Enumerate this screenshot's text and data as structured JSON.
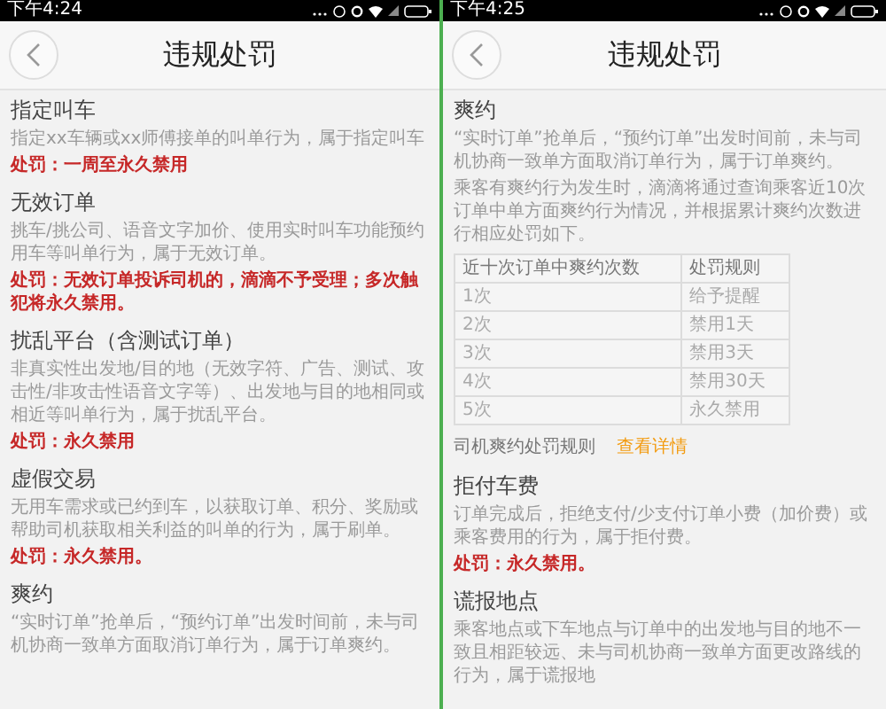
{
  "screens": [
    {
      "status_bar": {
        "time": "下午4:24"
      },
      "header": {
        "title": "违规处罚"
      },
      "sections": [
        {
          "title": "指定叫车",
          "blocks": [
            {
              "kind": "text",
              "text": "指定xx车辆或xx师傅接单的叫单行为，属于指定叫车"
            },
            {
              "kind": "penalty",
              "text": "处罚：一周至永久禁用"
            }
          ]
        },
        {
          "title": "无效订单",
          "blocks": [
            {
              "kind": "text",
              "text": "挑车/挑公司、语音文字加价、使用实时叫车功能预约用车等叫单行为，属于无效订单。"
            },
            {
              "kind": "penalty",
              "text": "处罚：无效订单投诉司机的，滴滴不予受理；多次触犯将永久禁用。"
            }
          ]
        },
        {
          "title": "扰乱平台（含测试订单）",
          "blocks": [
            {
              "kind": "text",
              "text": "非真实性出发地/目的地（无效字符、广告、测试、攻击性/非攻击性语音文字等）、出发地与目的地相同或相近等叫单行为，属于扰乱平台。"
            },
            {
              "kind": "penalty",
              "text": "处罚：永久禁用"
            }
          ]
        },
        {
          "title": "虚假交易",
          "blocks": [
            {
              "kind": "text",
              "text": "无用车需求或已约到车，以获取订单、积分、奖励或帮助司机获取相关利益的叫单的行为，属于刷单。"
            },
            {
              "kind": "penalty",
              "text": "处罚：永久禁用。"
            }
          ]
        },
        {
          "title": "爽约",
          "blocks": [
            {
              "kind": "text",
              "text": "“实时订单”抢单后，“预约订单”出发时间前，未与司机协商一致单方面取消订单行为，属于订单爽约。"
            }
          ]
        }
      ]
    },
    {
      "status_bar": {
        "time": "下午4:25"
      },
      "header": {
        "title": "违规处罚"
      },
      "sections": [
        {
          "title": "爽约",
          "blocks": [
            {
              "kind": "text",
              "text": "“实时订单”抢单后，“预约订单”出发时间前，未与司机协商一致单方面取消订单行为，属于订单爽约。"
            },
            {
              "kind": "text",
              "text": "乘客有爽约行为发生时，滴滴将通过查询乘客近10次订单中单方面爽约行为情况，并根据累计爽约次数进行相应处罚如下。"
            },
            {
              "kind": "table",
              "columns": [
                "近十次订单中爽约次数",
                "处罚规则"
              ],
              "rows": [
                [
                  "1次",
                  "给予提醒"
                ],
                [
                  "2次",
                  "禁用1天"
                ],
                [
                  "3次",
                  "禁用3天"
                ],
                [
                  "4次",
                  "禁用30天"
                ],
                [
                  "5次",
                  "永久禁用"
                ]
              ]
            },
            {
              "kind": "link_row",
              "label": "司机爽约处罚规则",
              "link": "查看详情"
            }
          ]
        },
        {
          "title": "拒付车费",
          "blocks": [
            {
              "kind": "text",
              "text": "订单完成后，拒绝支付/少支付订单小费（加价费）或乘客费用的行为，属于拒付费。"
            },
            {
              "kind": "penalty",
              "text": "处罚：永久禁用。"
            }
          ]
        },
        {
          "title": "谎报地点",
          "blocks": [
            {
              "kind": "text",
              "text": "乘客地点或下车地点与订单中的出发地与目的地不一致且相距较远、未与司机协商一致单方面更改路线的行为，属于谎报地"
            }
          ]
        }
      ]
    }
  ]
}
